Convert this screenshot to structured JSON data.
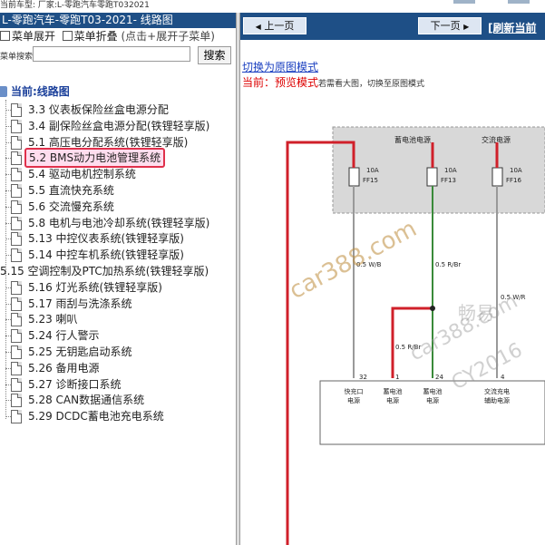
{
  "top_strip": {
    "text": "当前车型:   厂家:L-零跑汽车零跑T032021"
  },
  "left": {
    "title": "L-零跑汽车-零跑T03-2021- 线路图",
    "menu_expand": "菜单展开",
    "menu_collapse": "菜单折叠",
    "menu_hint": "(点击+展开子菜单)",
    "search_label": "菜单搜索",
    "search_value": "",
    "search_button": "搜索"
  },
  "tree": {
    "root": "当前:线路图",
    "items": [
      {
        "label": "3.3 仪表板保险丝盒电源分配"
      },
      {
        "label": "3.4 副保险丝盒电源分配(铁锂轻享版)"
      },
      {
        "label": "5.1 高压电分配系统(铁锂轻享版)"
      },
      {
        "label": "5.2 BMS动力电池管理系统",
        "selected": true
      },
      {
        "label": "5.4 驱动电机控制系统"
      },
      {
        "label": "5.5 直流快充系统"
      },
      {
        "label": "5.6 交流慢充系统"
      },
      {
        "label": "5.8 电机与电池冷却系统(铁锂轻享版)"
      },
      {
        "label": "5.13 中控仪表系统(铁锂轻享版)"
      },
      {
        "label": "5.14 中控车机系统(铁锂轻享版)"
      },
      {
        "label": "5.15 空调控制及PTC加热系统(铁锂轻享版)",
        "group": true
      },
      {
        "label": "5.16 灯光系统(铁锂轻享版)"
      },
      {
        "label": "5.17 雨刮与洗涤系统"
      },
      {
        "label": "5.23 喇叭"
      },
      {
        "label": "5.24 行人警示"
      },
      {
        "label": "5.25 无钥匙启动系统"
      },
      {
        "label": "5.26 备用电源"
      },
      {
        "label": "5.27 诊断接口系统"
      },
      {
        "label": "5.28 CAN数据通信系统"
      },
      {
        "label": "5.29 DCDC蓄电池充电系统"
      }
    ]
  },
  "right": {
    "prev_button": "上一页",
    "next_button": "下一页",
    "refresh_link": "[刷新当前",
    "switch_link": "切换为原图模式",
    "current_label": "当前：",
    "current_mode": "预览模式",
    "current_hint": "若需看大图，切换至原图模式"
  },
  "diagram": {
    "supply_labels": [
      "蓄电池电源",
      "交流电源"
    ],
    "fuses": [
      {
        "rating": "10A",
        "name": "FF15"
      },
      {
        "rating": "10A",
        "name": "FF13"
      },
      {
        "rating": "10A",
        "name": "FF16"
      }
    ],
    "wires": [
      "0.5 W/B",
      "0.5 R/Br",
      "0.5 R/Br",
      "0.5 W/R"
    ],
    "pins": [
      "32",
      "1",
      "24",
      "4"
    ],
    "pin_labels": [
      [
        "快充口",
        "电源"
      ],
      [
        "蓄电池",
        "电源"
      ],
      [
        "蓄电池",
        "电源"
      ],
      [
        "交流充电",
        "辅助电源"
      ]
    ],
    "watermarks": [
      "car388.com",
      "畅易",
      "car388.com",
      "CY2016"
    ],
    "colors": {
      "red_wire": "#d0202a",
      "gray_wire": "#999999",
      "green_wire": "#3a8a3a",
      "box_fill": "#d8d8d8"
    }
  }
}
